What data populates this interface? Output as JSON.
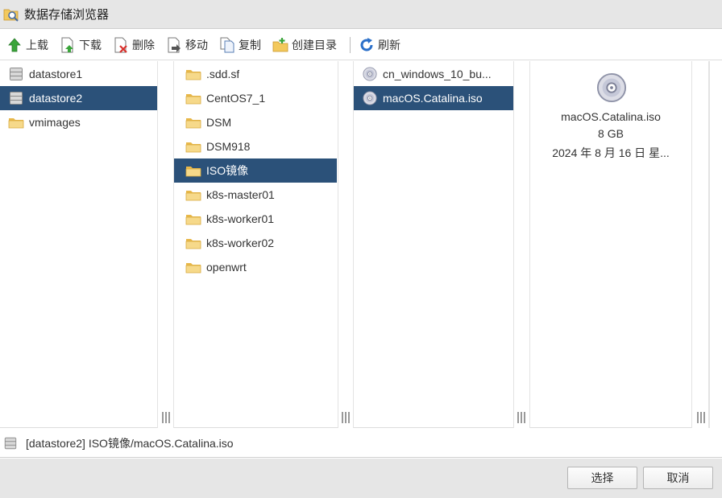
{
  "window": {
    "title": "数据存储浏览器",
    "icon": "datastore-browser-icon"
  },
  "toolbar": {
    "upload": "上载",
    "download": "下载",
    "delete": "删除",
    "move": "移动",
    "copy": "复制",
    "mkdir": "创建目录",
    "refresh": "刷新"
  },
  "col1": {
    "items": [
      {
        "label": "datastore1",
        "icon": "datastore-icon",
        "selected": false
      },
      {
        "label": "datastore2",
        "icon": "datastore-icon",
        "selected": true
      },
      {
        "label": "vmimages",
        "icon": "folder-icon",
        "selected": false
      }
    ]
  },
  "col2": {
    "items": [
      {
        "label": ".sdd.sf",
        "icon": "folder-icon",
        "selected": false
      },
      {
        "label": "CentOS7_1",
        "icon": "folder-icon",
        "selected": false
      },
      {
        "label": "DSM",
        "icon": "folder-icon",
        "selected": false
      },
      {
        "label": "DSM918",
        "icon": "folder-icon",
        "selected": false
      },
      {
        "label": "ISO镜像",
        "icon": "folder-icon",
        "selected": true
      },
      {
        "label": "k8s-master01",
        "icon": "folder-icon",
        "selected": false
      },
      {
        "label": "k8s-worker01",
        "icon": "folder-icon",
        "selected": false
      },
      {
        "label": "k8s-worker02",
        "icon": "folder-icon",
        "selected": false
      },
      {
        "label": "openwrt",
        "icon": "folder-icon",
        "selected": false
      }
    ]
  },
  "col3": {
    "items": [
      {
        "label": "cn_windows_10_bu...",
        "icon": "disc-icon",
        "selected": false
      },
      {
        "label": "macOS.Catalina.iso",
        "icon": "disc-icon",
        "selected": true
      }
    ]
  },
  "preview": {
    "icon": "disc-icon",
    "name": "macOS.Catalina.iso",
    "size": "8 GB",
    "date": "2024 年 8 月 16 日 星..."
  },
  "pathbar": {
    "path": "[datastore2] ISO镜像/macOS.Catalina.iso",
    "icon": "datastore-icon"
  },
  "footer": {
    "select": "选择",
    "cancel": "取消"
  },
  "colors": {
    "selection": "#2b5179",
    "folder": "#f3d27a",
    "upload_arrow": "#3aa53a",
    "refresh": "#2a6fc9"
  }
}
